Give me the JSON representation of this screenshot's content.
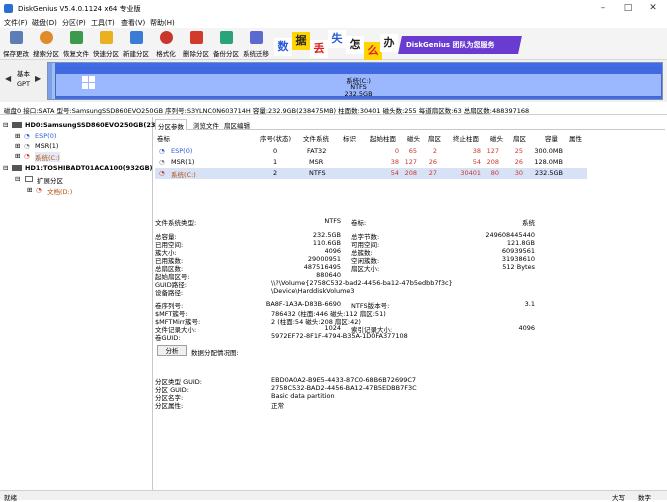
{
  "window": {
    "title": "DiskGenius V5.4.0.1124 x64 专业版"
  },
  "menu": [
    "文件(F)",
    "磁盘(D)",
    "分区(P)",
    "工具(T)",
    "查看(V)",
    "帮助(H)"
  ],
  "toolbar": [
    {
      "label": "保存更改",
      "icon": "save-icon",
      "color": "#5b7fb5"
    },
    {
      "label": "搜索分区",
      "icon": "search-partition-icon",
      "color": "#e08a2a"
    },
    {
      "label": "恢复文件",
      "icon": "recover-file-icon",
      "color": "#3c9a4c"
    },
    {
      "label": "快速分区",
      "icon": "quick-partition-icon",
      "color": "#e9b020"
    },
    {
      "label": "新建分区",
      "icon": "new-partition-icon",
      "color": "#3a7bd5"
    },
    {
      "label": "格式化",
      "icon": "format-icon",
      "color": "#c8372d"
    },
    {
      "label": "删除分区",
      "icon": "delete-partition-icon",
      "color": "#d23a2a"
    },
    {
      "label": "备份分区",
      "icon": "backup-partition-icon",
      "color": "#2aa37a"
    },
    {
      "label": "系统迁移",
      "icon": "system-migrate-icon",
      "color": "#5a6acf"
    }
  ],
  "banner": {
    "chars": [
      "数",
      "据",
      "丢",
      "失",
      "怎",
      "么",
      "办"
    ],
    "slogan": "DiskGenius 团队为您服务"
  },
  "disk_nav": {
    "line1": "基本",
    "line2": "GPT"
  },
  "disk_graphic": {
    "name": "系统(C:)",
    "fs": "NTFS",
    "size": "232.5GB"
  },
  "disk_info": "磁盘0 接口:SATA  型号:SamsungSSD860EVO250GB  序列号:S3YLNC0N603714H  容量:232.9GB(238475MB)  柱面数:30401  磁头数:255  每道扇区数:63  总扇区数:488397168",
  "tree": {
    "disk0": "HD0:SamsungSSD860EVO250GB(233",
    "disk0_parts": [
      "ESP(0)",
      "MSR(1)",
      "系统(C:)"
    ],
    "disk1": "HD1:TOSHIBADT01ACA100(932GB)",
    "disk1_ext": "扩展分区",
    "disk1_parts": [
      "文档(D:)"
    ]
  },
  "tabs": [
    "分区参数",
    "浏览文件",
    "扇区编辑"
  ],
  "partition_table": {
    "headers": [
      "卷标",
      "序号(状态)",
      "文件系统",
      "标识",
      "起始柱面",
      "磁头",
      "扇区",
      "终止柱面",
      "磁头",
      "扇区",
      "容量",
      "属性"
    ],
    "rows": [
      [
        "ESP(0)",
        "0",
        "FAT32",
        "",
        "0",
        "65",
        "2",
        "38",
        "127",
        "25",
        "300.0MB",
        ""
      ],
      [
        "MSR(1)",
        "1",
        "MSR",
        "",
        "38",
        "127",
        "26",
        "54",
        "208",
        "26",
        "128.0MB",
        ""
      ],
      [
        "系统(C:)",
        "2",
        "NTFS",
        "",
        "54",
        "208",
        "27",
        "30401",
        "80",
        "30",
        "232.5GB",
        ""
      ]
    ]
  },
  "details": {
    "fs_type_label": "文件系统类型:",
    "fs_type_value": "NTFS",
    "vol_label_label": "卷标:",
    "vol_label_value": "系统",
    "total_label": "总容量:",
    "total_value": "232.5GB",
    "total_bytes_label": "总字节数:",
    "total_bytes_value": "249608445440",
    "used_label": "已用空间:",
    "used_value": "110.6GB",
    "free_label": "可用空间:",
    "free_value": "121.8GB",
    "cluster_label": "簇大小:",
    "cluster_value": "4096",
    "total_clusters_label": "总簇数:",
    "total_clusters_value": "60939561",
    "used_clusters_label": "已用簇数:",
    "used_clusters_value": "29000951",
    "free_clusters_label": "空闲簇数:",
    "free_clusters_value": "31938610",
    "sectors_label": "总扇区数:",
    "sectors_value": "487516495",
    "sector_size_label": "扇区大小:",
    "sector_size_value": "512 Bytes",
    "start_sector_label": "起始扇区号:",
    "start_sector_value": "880640",
    "guid_path_label": "GUID路径:",
    "guid_path_value": "\\\\?\\Volume{2758C532-bad2-4456-ba12-47b5edbb7f3c}",
    "device_path_label": "设备路径:",
    "device_path_value": "\\Device\\HarddiskVolume3",
    "serial_label": "卷序列号:",
    "serial_value": "BA8F-1A3A-D83B-6690",
    "ntfs_ver_label": "NTFS版本号:",
    "ntfs_ver_value": "3.1",
    "mft_label": "$MFT簇号:",
    "mft_value": "786432 (柱面:446 磁头:112 扇区:51)",
    "mftmirr_label": "$MFTMirr簇号:",
    "mftmirr_value": "2 (柱面:54 磁头:208 扇区:42)",
    "record_label": "文件记录大小:",
    "record_value": "1024",
    "index_label": "索引记录大小:",
    "index_value": "4096",
    "volguid_label": "卷GUID:",
    "volguid_value": "5972EF72-8F1F-4794-B35A-1D0FA377108",
    "analyze_button": "分析",
    "graph_label": "数据分配情况图:",
    "ptype_guid_label": "分区类型 GUID:",
    "ptype_guid_value": "EBD0A0A2-B9E5-4433-87C0-68B6B72699C7",
    "p_guid_label": "分区 GUID:",
    "p_guid_value": "2758C532-BAD2-4456-BA12-47B5EDBB7F3C",
    "p_name_label": "分区名字:",
    "p_name_value": "Basic data partition",
    "p_attr_label": "分区属性:",
    "p_attr_value": "正常"
  },
  "status": {
    "left": "就绪",
    "caps": "大写",
    "num": "数字"
  }
}
